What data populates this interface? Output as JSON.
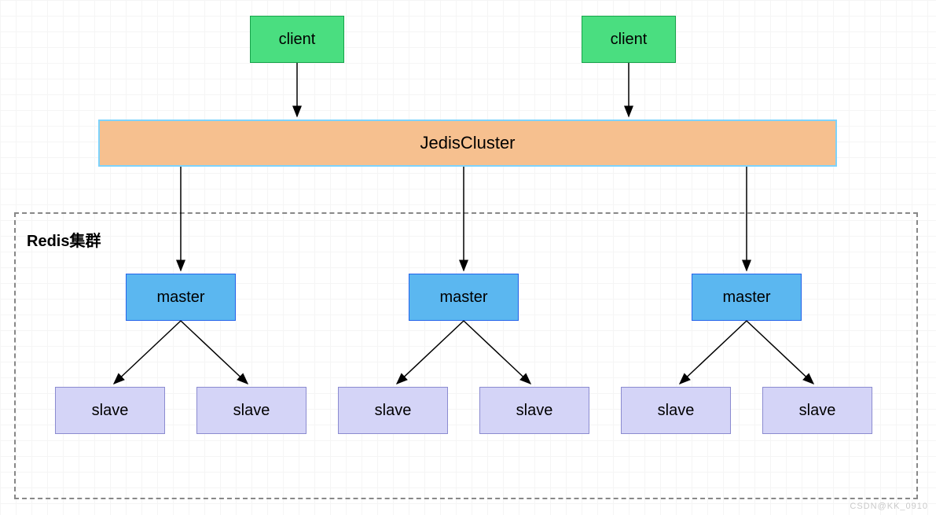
{
  "clients": [
    {
      "label": "client"
    },
    {
      "label": "client"
    }
  ],
  "cluster": {
    "label": "JedisCluster"
  },
  "group": {
    "label": "Redis集群"
  },
  "masters": [
    {
      "label": "master",
      "slaves": [
        {
          "label": "slave"
        },
        {
          "label": "slave"
        }
      ]
    },
    {
      "label": "master",
      "slaves": [
        {
          "label": "slave"
        },
        {
          "label": "slave"
        }
      ]
    },
    {
      "label": "master",
      "slaves": [
        {
          "label": "slave"
        },
        {
          "label": "slave"
        }
      ]
    }
  ],
  "watermark": "CSDN@KK_0910"
}
